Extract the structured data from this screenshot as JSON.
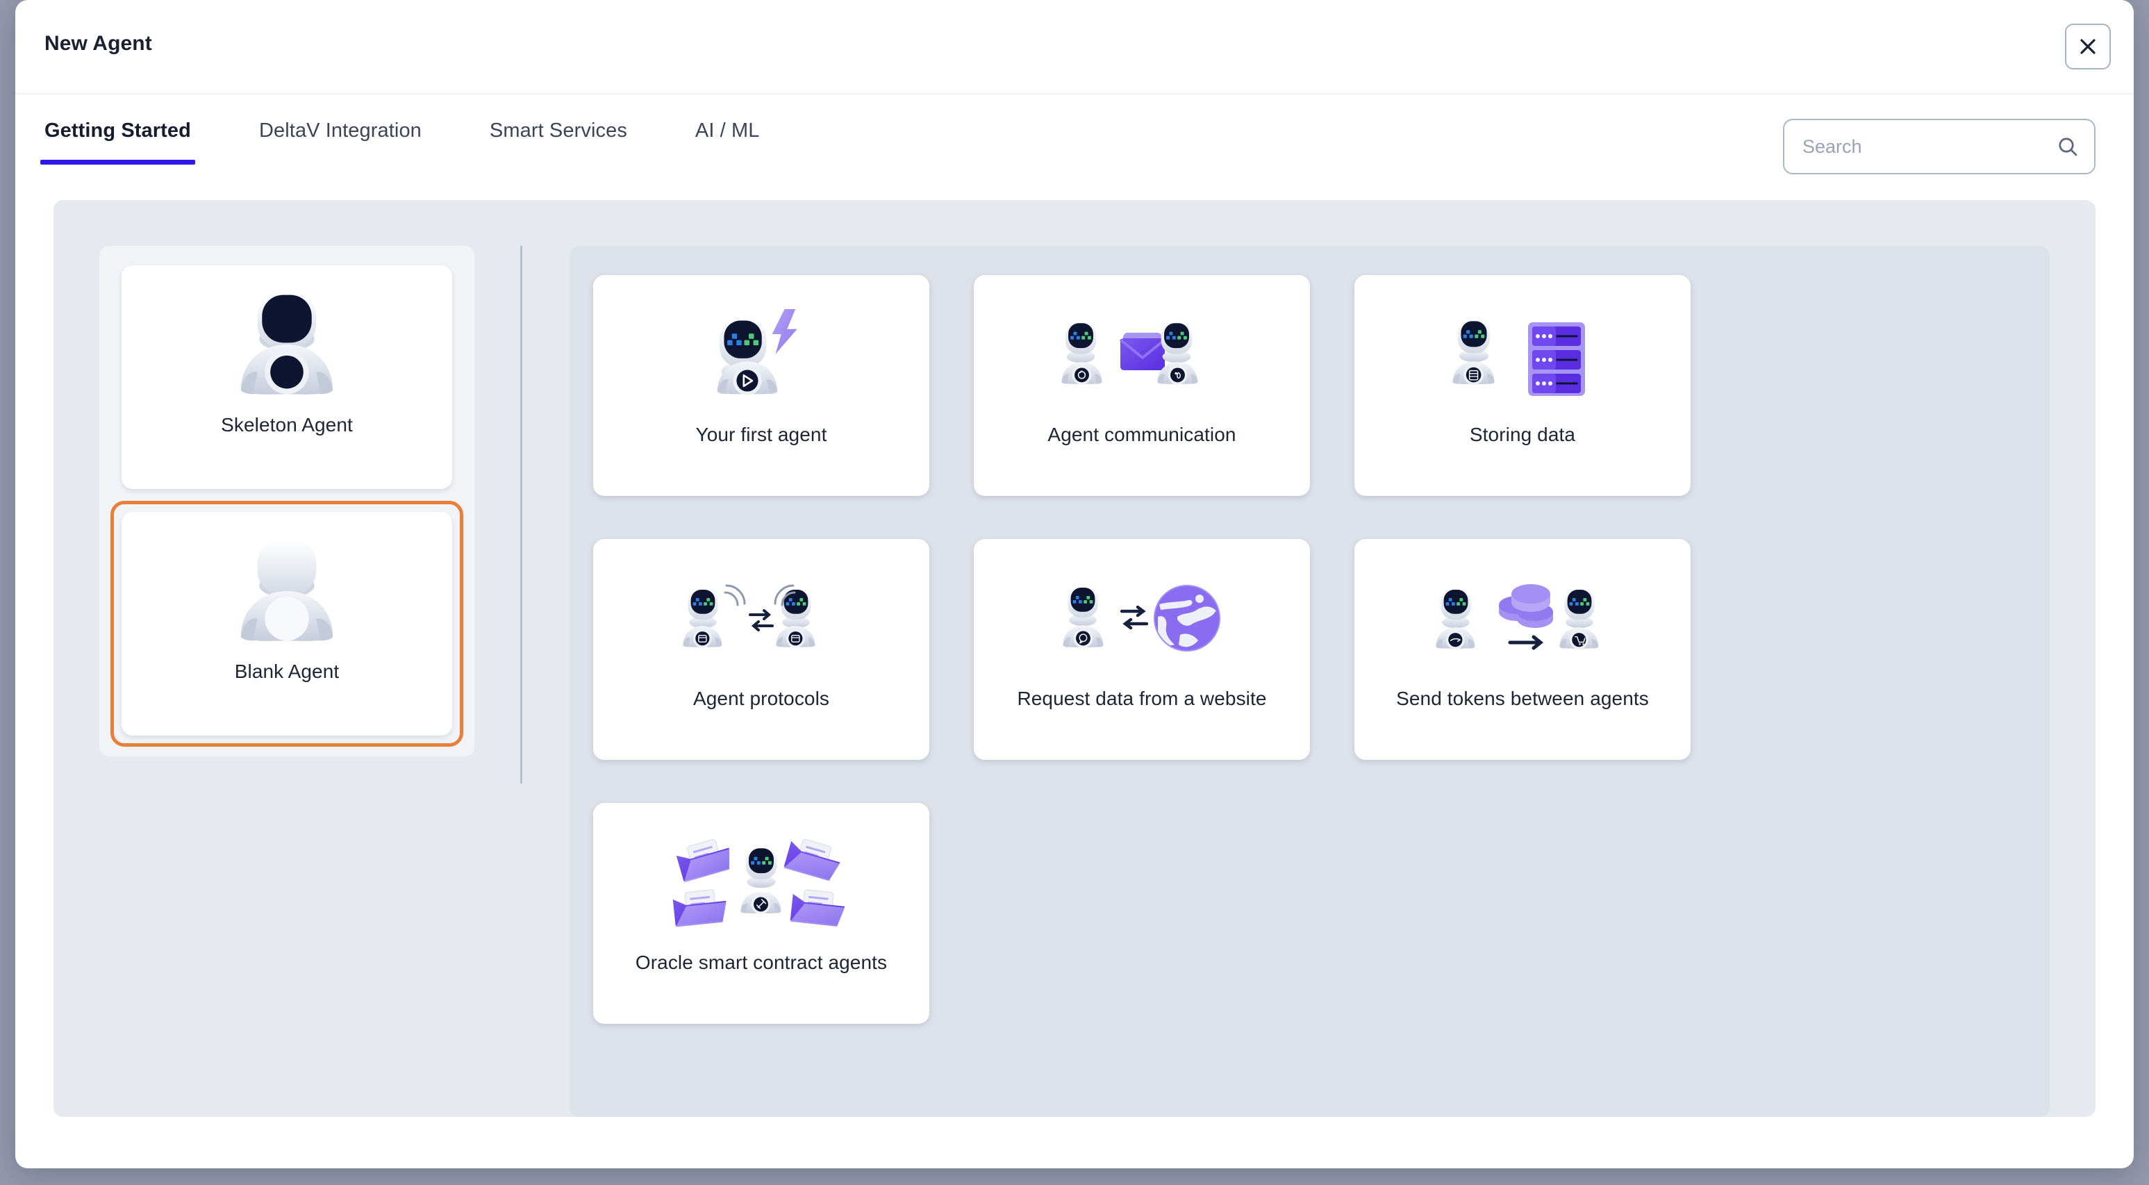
{
  "window": {
    "title": "New Agent",
    "close_icon": "close-icon",
    "close_label": "×"
  },
  "tabs": [
    {
      "label": "Getting Started",
      "active": true
    },
    {
      "label": "DeltaV Integration",
      "active": false
    },
    {
      "label": "Smart Services",
      "active": false
    },
    {
      "label": "AI / ML",
      "active": false
    }
  ],
  "search": {
    "placeholder": "Search",
    "value": "",
    "icon": "search-icon"
  },
  "sidebar": {
    "items": [
      {
        "label": "Skeleton Agent",
        "icon": "skeleton-agent-icon",
        "selected": false
      },
      {
        "label": "Blank Agent",
        "icon": "blank-agent-icon",
        "selected": true
      }
    ]
  },
  "templates": [
    {
      "label": "Your first agent",
      "icon": "robot-lightning-icon"
    },
    {
      "label": "Agent communication",
      "icon": "two-robots-envelope-icon"
    },
    {
      "label": "Storing data",
      "icon": "robot-server-icon"
    },
    {
      "label": "Agent protocols",
      "icon": "two-robots-exchange-icon"
    },
    {
      "label": "Request data from a website",
      "icon": "robot-globe-icon"
    },
    {
      "label": "Send tokens between agents",
      "icon": "robot-coins-robot-icon"
    },
    {
      "label": "Oracle smart contract agents",
      "icon": "robot-folders-icon"
    }
  ],
  "colors": {
    "accent": "#3018e8",
    "selection": "#e8803a",
    "purple": "#6b42e8",
    "purple_light": "#9b85f0",
    "navy": "#0d1530",
    "eye_blue": "#2f7de0",
    "eye_green": "#4fc878",
    "backdrop": "#9499ad",
    "panel": "#e6e9ef",
    "grid_panel": "#dde1e9"
  }
}
